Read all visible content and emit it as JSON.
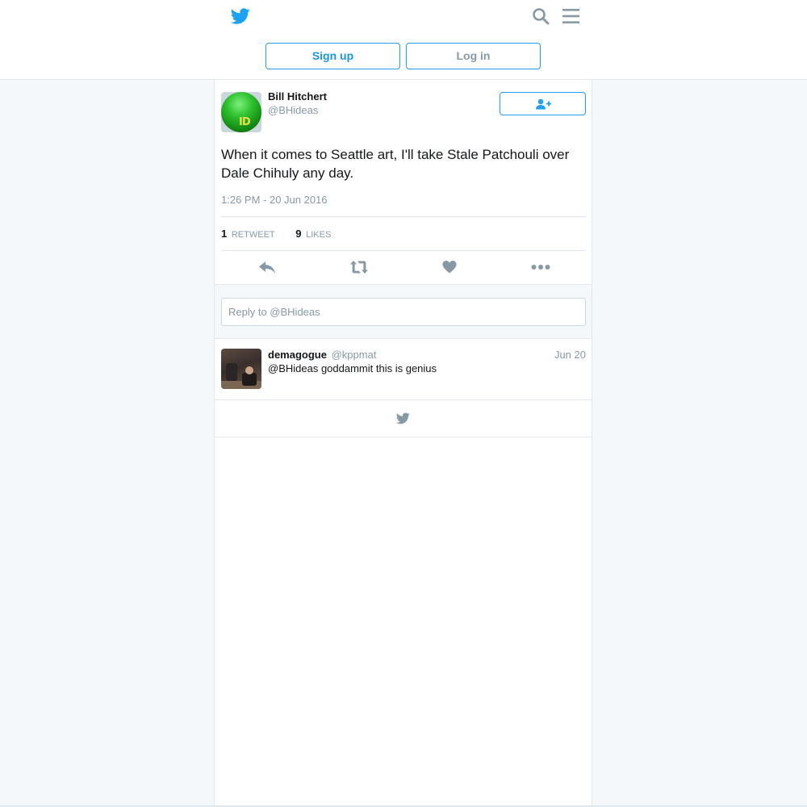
{
  "header": {
    "logo_icon": "twitter-bird-icon",
    "search_icon": "search-icon",
    "menu_icon": "hamburger-menu-icon",
    "signup_label": "Sign up",
    "login_label": "Log in",
    "accent_color": "#1da1f2"
  },
  "tweet": {
    "author_name": "Bill Hitchert",
    "author_handle": "@BHideas",
    "follow_icon": "follow-user-plus-icon",
    "text": "When it comes to Seattle art, I'll take Stale Patchouli over Dale Chihuly any day.",
    "timestamp": "1:26 PM - 20 Jun 2016",
    "retweet_count": "1",
    "retweet_label": "Retweet",
    "likes_count": "9",
    "likes_label": "Likes",
    "actions": [
      "reply-icon",
      "retweet-icon",
      "like-heart-icon",
      "more-dots-icon"
    ]
  },
  "reply_box": {
    "placeholder": "Reply to @BHideas"
  },
  "replies": [
    {
      "name": "demagogue",
      "handle": "@kppmat",
      "date": "Jun 20",
      "text": "@BHideas goddammit this is genius"
    }
  ],
  "footer": {
    "icon": "twitter-bird-icon"
  }
}
